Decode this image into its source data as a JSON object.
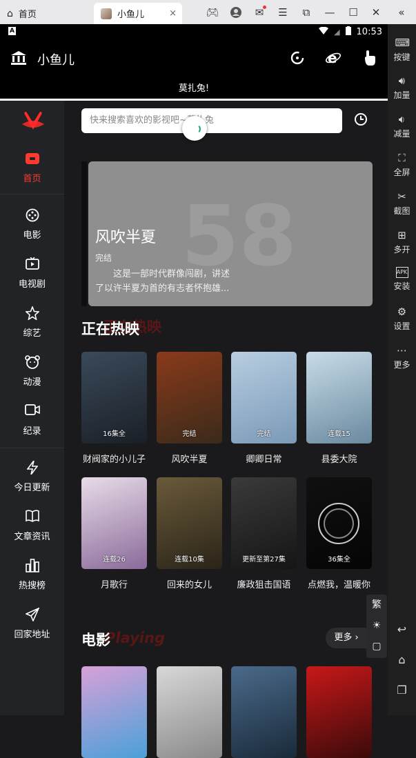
{
  "browser": {
    "home_tab": "首页",
    "app_tab": "小鱼儿",
    "close": "×"
  },
  "status": {
    "indicator": "A",
    "time": "10:53"
  },
  "header": {
    "title": "小鱼儿",
    "banner_text": "莫扎兔!"
  },
  "emulator_sidebar": {
    "items": [
      {
        "label": "按键",
        "icon": "keyboard-icon"
      },
      {
        "label": "加量",
        "icon": "volume-up-icon"
      },
      {
        "label": "减量",
        "icon": "volume-down-icon"
      },
      {
        "label": "全屏",
        "icon": "fullscreen-icon"
      },
      {
        "label": "截图",
        "icon": "scissors-icon"
      },
      {
        "label": "多开",
        "icon": "multi-instance-icon"
      },
      {
        "label": "安装",
        "icon": "apk-icon"
      },
      {
        "label": "设置",
        "icon": "gear-icon"
      },
      {
        "label": "更多",
        "icon": "more-icon"
      }
    ]
  },
  "nav": {
    "items": [
      {
        "label": "首页",
        "icon": "home-icon",
        "active": true
      },
      {
        "label": "电影",
        "icon": "film-reel-icon"
      },
      {
        "label": "电视剧",
        "icon": "tv-icon"
      },
      {
        "label": "综艺",
        "icon": "star-icon"
      },
      {
        "label": "动漫",
        "icon": "bear-icon"
      },
      {
        "label": "纪录",
        "icon": "camera-icon"
      },
      {
        "label": "今日更新",
        "icon": "lightning-icon"
      },
      {
        "label": "文章资讯",
        "icon": "book-icon"
      },
      {
        "label": "热搜榜",
        "icon": "bar-chart-icon"
      },
      {
        "label": "回家地址",
        "icon": "send-icon"
      }
    ]
  },
  "search": {
    "placeholder": "快来搜索喜欢的影视吧~莫扎兔"
  },
  "banner": {
    "title": "风吹半夏",
    "status": "完结",
    "description": "这是一部时代群像闯剧，讲述了以许半夏为首的有志者怀抱雄...",
    "bg_number": "58"
  },
  "hot_section": {
    "title": "正在热映",
    "ghost": "正在热映",
    "items": [
      {
        "name": "财阀家的小儿子",
        "badge": "16集全",
        "color1": "#3a4a5a",
        "color2": "#1a1f26"
      },
      {
        "name": "风吹半夏",
        "badge": "完结",
        "color1": "#8a3a1a",
        "color2": "#3a2a1a"
      },
      {
        "name": "卿卿日常",
        "badge": "完结",
        "color1": "#b8cde0",
        "color2": "#7a9ab8"
      },
      {
        "name": "县委大院",
        "badge": "连载15",
        "color1": "#c8dce8",
        "color2": "#6a8aa0"
      },
      {
        "name": "月歌行",
        "badge": "连载26",
        "color1": "#e8dce8",
        "color2": "#8a6a9a"
      },
      {
        "name": "回来的女儿",
        "badge": "连载10集",
        "color1": "#6a5a3a",
        "color2": "#2a2418"
      },
      {
        "name": "廉政狙击国语",
        "badge": "更新至第27集",
        "color1": "#3a3a3a",
        "color2": "#151515"
      },
      {
        "name": "点燃我，温暖你",
        "badge": "36集全",
        "color1": "#101010",
        "color2": "#050505"
      }
    ]
  },
  "movie_section": {
    "title": "电影",
    "ghost": "Playing",
    "more": "更多 ›",
    "items": [
      {
        "color1": "#d8a0d8",
        "color2": "#4aa0d8"
      },
      {
        "color1": "#d8d8d8",
        "color2": "#8a8a8a"
      },
      {
        "color1": "#4a6a8a",
        "color2": "#1a2a3a"
      },
      {
        "color1": "#c81818",
        "color2": "#3a0a0a"
      }
    ]
  },
  "float_tools": {
    "trad": "繁",
    "brightness": "☀",
    "feedback": "▢"
  }
}
